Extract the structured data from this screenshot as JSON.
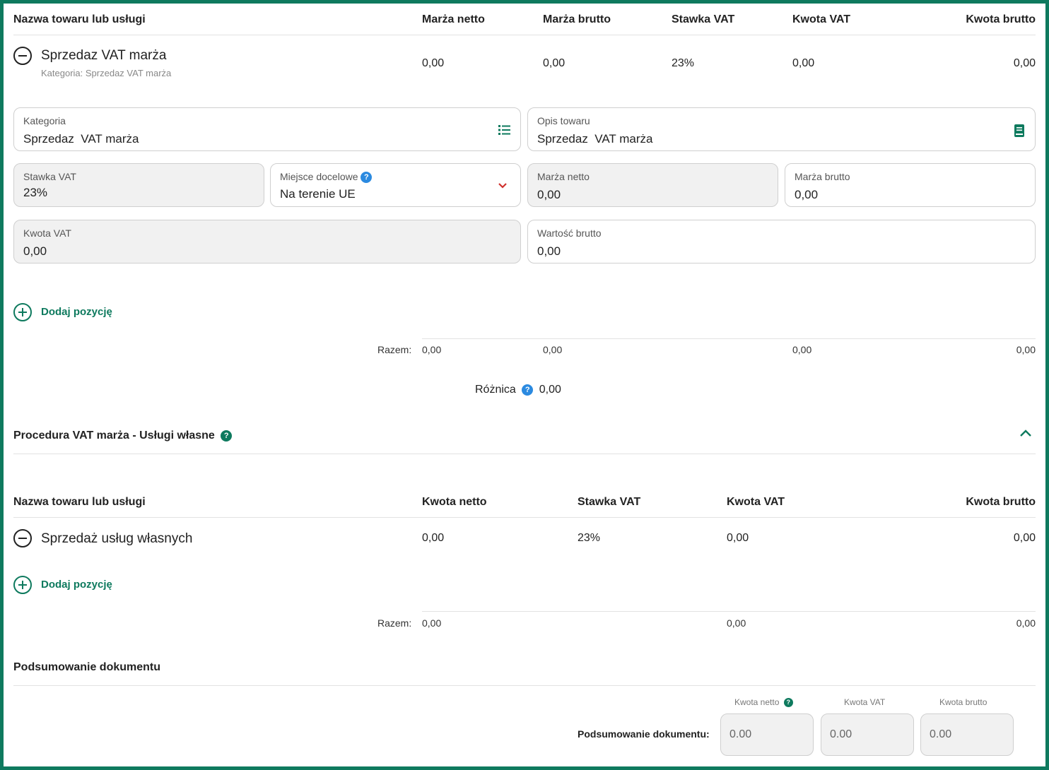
{
  "section1": {
    "headers": {
      "name": "Nazwa towaru lub usługi",
      "marza_netto": "Marża netto",
      "marza_brutto": "Marża brutto",
      "stawka_vat": "Stawka VAT",
      "kwota_vat": "Kwota VAT",
      "kwota_brutto": "Kwota brutto"
    },
    "item": {
      "name": "Sprzedaz VAT marża",
      "category_caption": "Kategoria: Sprzedaz VAT marża",
      "marza_netto": "0,00",
      "marza_brutto": "0,00",
      "stawka_vat": "23%",
      "kwota_vat": "0,00",
      "kwota_brutto": "0,00"
    },
    "form": {
      "kategoria_label": "Kategoria",
      "kategoria_value": "Sprzedaz  VAT marża",
      "opis_label": "Opis towaru",
      "opis_value": "Sprzedaz  VAT marża",
      "stawka_label": "Stawka VAT",
      "stawka_value": "23%",
      "miejsce_label": "Miejsce docelowe",
      "miejsce_value": "Na terenie UE",
      "marza_netto_label": "Marża netto",
      "marza_netto_value": "0,00",
      "marza_brutto_label": "Marża brutto",
      "marza_brutto_value": "0,00",
      "kwota_vat_label": "Kwota VAT",
      "kwota_vat_value": "0,00",
      "wartosc_label": "Wartość brutto",
      "wartosc_value": "0,00"
    },
    "add_label": "Dodaj pozycję",
    "totals": {
      "label": "Razem:",
      "marza_netto": "0,00",
      "marza_brutto": "0,00",
      "kwota_vat": "0,00",
      "kwota_brutto": "0,00"
    },
    "roznica_label": "Różnica",
    "roznica_value": "0,00"
  },
  "section2": {
    "title": "Procedura VAT marża - Usługi własne",
    "headers": {
      "name": "Nazwa towaru lub usługi",
      "kwota_netto": "Kwota netto",
      "stawka_vat": "Stawka VAT",
      "kwota_vat": "Kwota VAT",
      "kwota_brutto": "Kwota brutto"
    },
    "item": {
      "name": "Sprzedaż usług własnych",
      "kwota_netto": "0,00",
      "stawka_vat": "23%",
      "kwota_vat": "0,00",
      "kwota_brutto": "0,00"
    },
    "add_label": "Dodaj pozycję",
    "totals": {
      "label": "Razem:",
      "kwota_netto": "0,00",
      "kwota_vat": "0,00",
      "kwota_brutto": "0,00"
    }
  },
  "summary": {
    "title": "Podsumowanie dokumentu",
    "row_label": "Podsumowanie dokumentu:",
    "col_netto": "Kwota netto",
    "col_vat": "Kwota VAT",
    "col_brutto": "Kwota brutto",
    "netto": "0.00",
    "vat": "0.00",
    "brutto": "0.00"
  },
  "colors": {
    "accent": "#0e7a5e",
    "help_blue": "#2b8ae0",
    "chevron_red": "#d0312d"
  }
}
